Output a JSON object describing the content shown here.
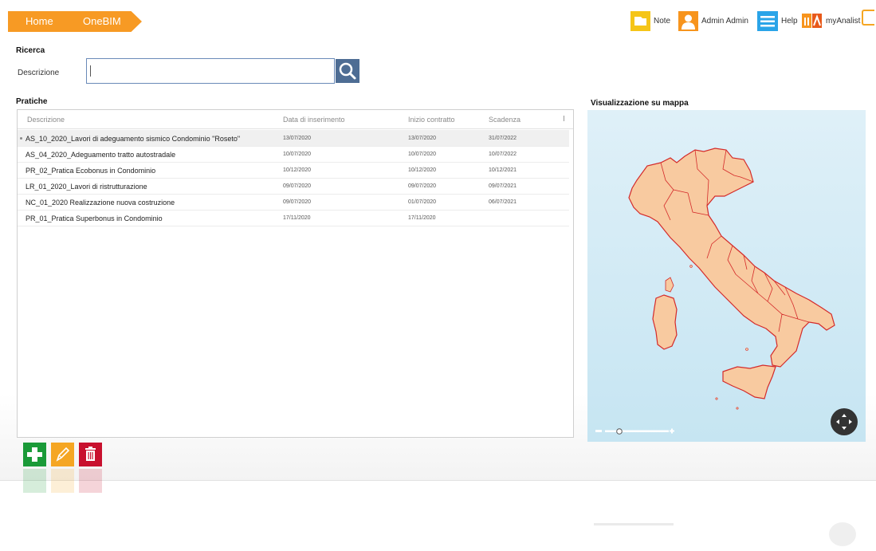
{
  "breadcrumb": {
    "home": "Home",
    "current": "OneBIM"
  },
  "toolbar": {
    "note": "Note",
    "user": "Admin Admin",
    "help": "Help",
    "analist": "myAnalist"
  },
  "search": {
    "title": "Ricerca",
    "label": "Descrizione",
    "value": "",
    "placeholder": ""
  },
  "table": {
    "title": "Pratiche",
    "columns": [
      "Descrizione",
      "Data di inserimento",
      "Inizio contratto",
      "Scadenza"
    ],
    "rows": [
      {
        "descrizione": "AS_10_2020_Lavori di adeguamento sismico Condominio \"Roseto\"",
        "data_inserimento": "13/07/2020",
        "inizio_contratto": "13/07/2020",
        "scadenza": "31/07/2022"
      },
      {
        "descrizione": "AS_04_2020_Adeguamento tratto autostradale",
        "data_inserimento": "10/07/2020",
        "inizio_contratto": "10/07/2020",
        "scadenza": "10/07/2022"
      },
      {
        "descrizione": "PR_02_Pratica Ecobonus in Condominio",
        "data_inserimento": "10/12/2020",
        "inizio_contratto": "10/12/2020",
        "scadenza": "10/12/2021"
      },
      {
        "descrizione": "LR_01_2020_Lavori di ristrutturazione",
        "data_inserimento": "09/07/2020",
        "inizio_contratto": "09/07/2020",
        "scadenza": "09/07/2021"
      },
      {
        "descrizione": "NC_01_2020 Realizzazione nuova costruzione",
        "data_inserimento": "09/07/2020",
        "inizio_contratto": "01/07/2020",
        "scadenza": "06/07/2021"
      },
      {
        "descrizione": "PR_01_Pratica Superbonus in Condominio",
        "data_inserimento": "17/11/2020",
        "inizio_contratto": "17/11/2020",
        "scadenza": ""
      }
    ]
  },
  "map": {
    "title": "Visualizzazione su mappa"
  },
  "icons": {
    "note": "note-icon",
    "user": "user-icon",
    "help": "help-menu-icon",
    "analist": "myanalist-logo-icon",
    "search": "search-icon",
    "add": "add-icon",
    "edit": "edit-icon",
    "delete": "delete-icon",
    "navigate": "pan-control-icon"
  },
  "colors": {
    "breadcrumb": "#f79a24",
    "note": "#f5c518",
    "user": "#f7941d",
    "help": "#2aa4e8",
    "search_button": "#4e6d94",
    "add": "#1a9a38",
    "edit": "#f5a623",
    "delete": "#c8102e",
    "map_fill": "#f8caa0",
    "map_border": "#d42a2a",
    "sea": "#cfe9f4"
  }
}
